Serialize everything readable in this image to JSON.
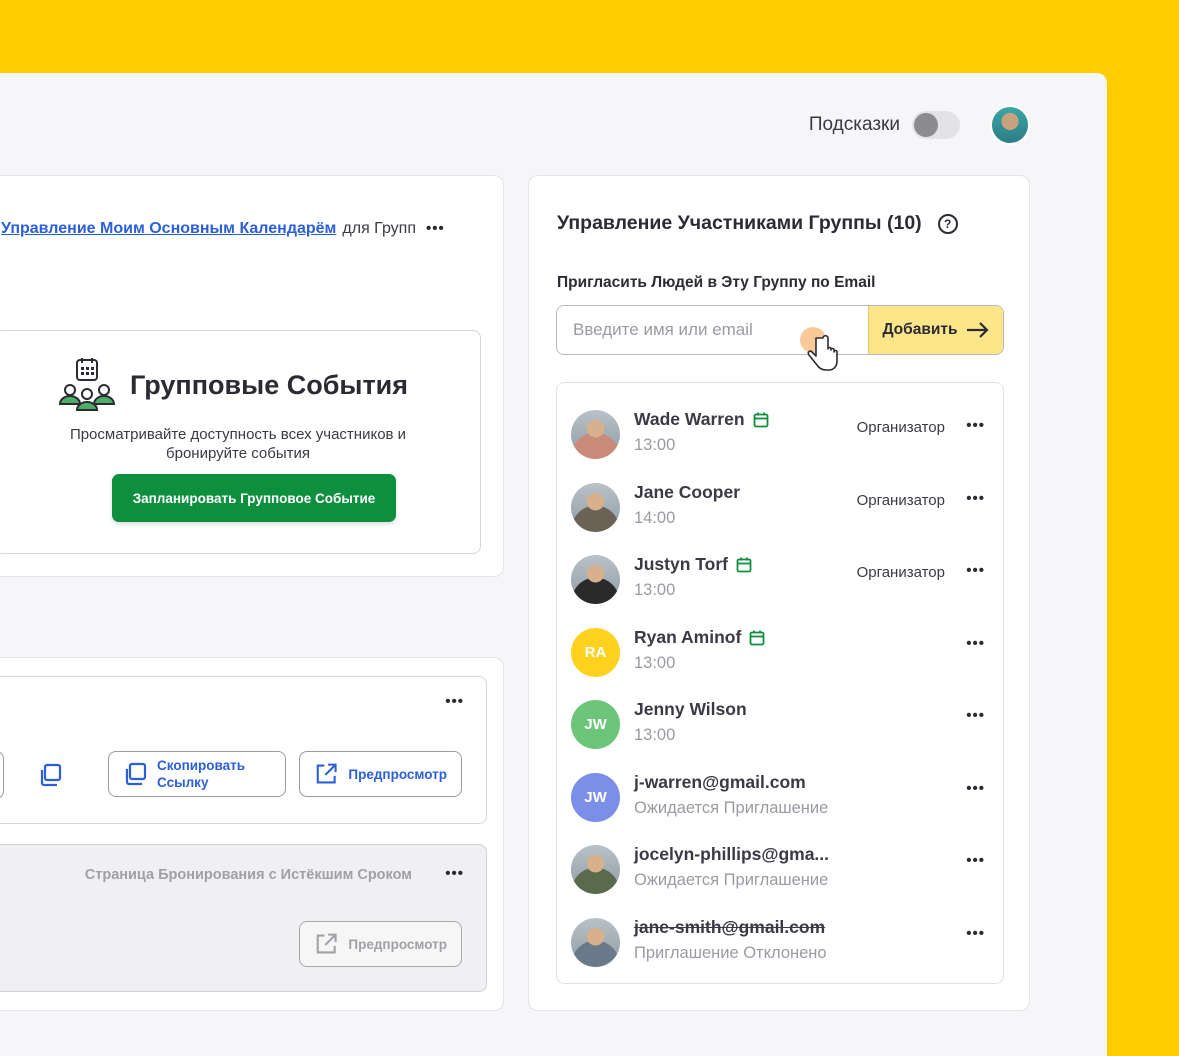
{
  "topbar": {
    "hints_label": "Подсказки",
    "hints_on": false
  },
  "calendar_line": {
    "link": "Управление Моим Основным Календарём",
    "suffix": "для Групп",
    "more": "•••"
  },
  "group_events": {
    "title": "Групповые События",
    "description": "Просматривайте доступность всех участников и бронируйте события",
    "button": "Запланировать Групповое Событие"
  },
  "links_card": {
    "more": "•••",
    "copy_button": "Скопировать Ссылку",
    "preview_button": "Предпросмотр",
    "expired_label": "Страница Бронирования с Истёкшим Сроком",
    "expired_preview_button": "Предпросмотр"
  },
  "members_panel": {
    "title": "Управление Участниками Группы (10)",
    "help_icon": "?",
    "invite_label": "Пригласить Людей в Эту Группу по Email",
    "input_placeholder": "Введите имя или email",
    "add_button": "Добавить",
    "members": [
      {
        "name": "Wade Warren",
        "sub": "13:00",
        "role": "Организатор",
        "calendar": true,
        "initials": "",
        "color": "#c98a7a",
        "more": "•••"
      },
      {
        "name": "Jane Cooper",
        "sub": "14:00",
        "role": "Организатор",
        "calendar": false,
        "initials": "",
        "color": "#6b6256",
        "more": "•••"
      },
      {
        "name": "Justyn Torf",
        "sub": "13:00",
        "role": "Организатор",
        "calendar": true,
        "initials": "",
        "color": "#2a2a2a",
        "more": "•••"
      },
      {
        "name": "Ryan Aminof",
        "sub": "13:00",
        "role": "",
        "calendar": true,
        "initials": "RA",
        "color": "#FFD21F",
        "more": "•••"
      },
      {
        "name": "Jenny Wilson",
        "sub": "13:00",
        "role": "",
        "calendar": false,
        "initials": "JW",
        "color": "#6cc57a",
        "more": "•••"
      },
      {
        "name": "j-warren@gmail.com",
        "sub": "Ожидается Приглашение",
        "role": "",
        "calendar": false,
        "initials": "JW",
        "color": "#7b8fe8",
        "more": "•••"
      },
      {
        "name": "jocelyn-phillips@gma...",
        "sub": "Ожидается Приглашение",
        "role": "",
        "calendar": false,
        "initials": "",
        "color": "#5a6b4c",
        "more": "•••"
      },
      {
        "name": "jane-smith@gmail.com",
        "sub": "Приглашение Отклонено",
        "role": "",
        "calendar": false,
        "initials": "",
        "color": "#6a7a8a",
        "more": "•••",
        "declined": true
      }
    ]
  },
  "colors": {
    "accent_yellow": "#FFCC00",
    "green": "#0e8f3e",
    "link_blue": "#2b5fd9",
    "calendar_green": "#0e8f3e"
  }
}
